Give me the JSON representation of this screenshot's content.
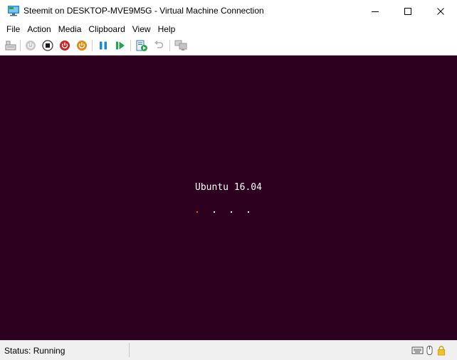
{
  "window": {
    "title": "Steemit on DESKTOP-MVE9M5G - Virtual Machine Connection",
    "controls": [
      "minimize-icon",
      "maximize-icon",
      "close-icon"
    ]
  },
  "menu": {
    "items": [
      "File",
      "Action",
      "Media",
      "Clipboard",
      "View",
      "Help"
    ]
  },
  "toolbar": {
    "buttons": [
      {
        "icon": "ctrl-alt-del-icon",
        "enabled": true
      },
      {
        "icon": "start-icon",
        "enabled": false
      },
      {
        "icon": "turn-off-icon",
        "enabled": true
      },
      {
        "icon": "shut-down-icon",
        "enabled": true
      },
      {
        "icon": "save-icon",
        "enabled": true
      },
      {
        "icon": "pause-icon",
        "enabled": true
      },
      {
        "icon": "reset-icon",
        "enabled": true
      },
      {
        "icon": "checkpoint-icon",
        "enabled": true
      },
      {
        "icon": "revert-icon",
        "enabled": false
      },
      {
        "icon": "enhanced-session-icon",
        "enabled": false
      }
    ]
  },
  "screen": {
    "background": "#2c001e",
    "boot_text": "Ubuntu 16.04",
    "progress_dots": [
      {
        "color": "#e95420",
        "active": true
      },
      {
        "color": "#ffffff",
        "active": false
      },
      {
        "color": "#ffffff",
        "active": false
      },
      {
        "color": "#ffffff",
        "active": false
      }
    ]
  },
  "status": {
    "text": "Status: Running",
    "icons": [
      "keyboard-icon",
      "mouse-icon",
      "lock-icon"
    ]
  }
}
